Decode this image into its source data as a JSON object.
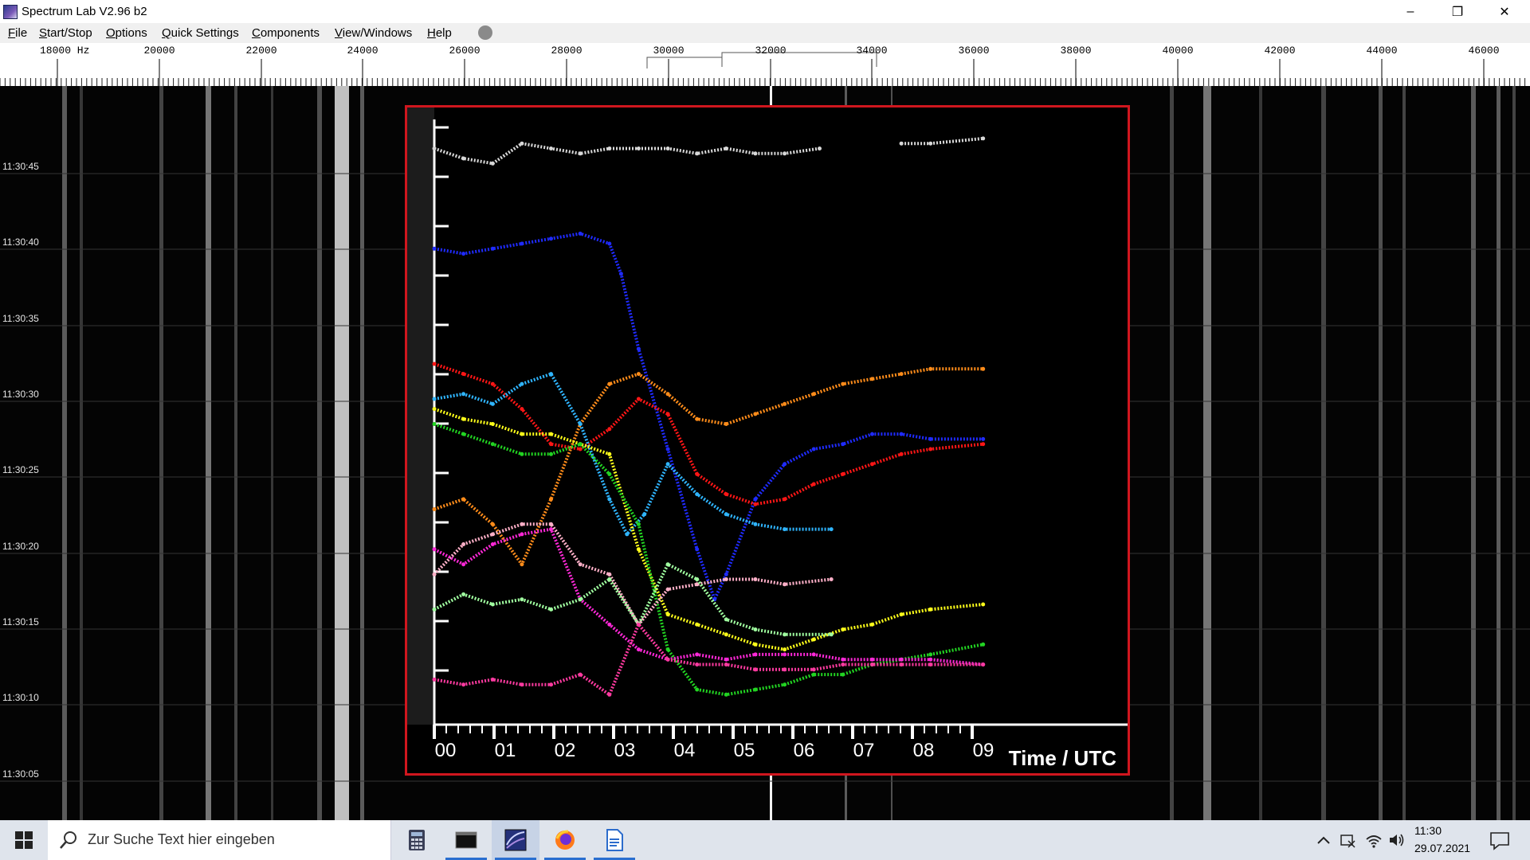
{
  "window": {
    "title": "Spectrum Lab V2.96 b2",
    "minimize_glyph": "–",
    "restore_glyph": "❐",
    "close_glyph": "✕"
  },
  "menu": {
    "items": [
      {
        "label": "File",
        "ul": "F",
        "rest": "ile"
      },
      {
        "label": "Start/Stop",
        "ul": "S",
        "rest": "tart/Stop"
      },
      {
        "label": "Options",
        "ul": "O",
        "rest": "ptions"
      },
      {
        "label": "Quick Settings",
        "ul": "Q",
        "rest": "uick Settings"
      },
      {
        "label": "Components",
        "ul": "C",
        "rest": "omponents"
      },
      {
        "label": "View/Windows",
        "ul": "V",
        "rest": "iew/Windows"
      },
      {
        "label": "Help",
        "ul": "H",
        "rest": "elp"
      }
    ]
  },
  "frequency_scale": {
    "unit": "Hz",
    "labels": [
      "18000 Hz",
      "20000",
      "22000",
      "24000",
      "26000",
      "28000",
      "30000",
      "32000",
      "34000",
      "36000",
      "38000",
      "40000",
      "42000",
      "44000",
      "46000"
    ]
  },
  "waterfall": {
    "time_labels": [
      "11:30:45",
      "11:30:40",
      "11:30:35",
      "11:30:30",
      "11:30:25",
      "11:30:20",
      "11:30:15",
      "11:30:10",
      "11:30:05"
    ]
  },
  "inset_plot": {
    "border_color": "#d0161e",
    "xlabel": "Time / UTC",
    "x_ticks": [
      "00",
      "01",
      "02",
      "03",
      "04",
      "05",
      "06",
      "07",
      "08",
      "09"
    ],
    "chart_data": {
      "type": "scatter",
      "xlabel": "Time / UTC",
      "x_range": [
        0,
        9.5
      ],
      "y_range": [
        0,
        12
      ],
      "series": [
        {
          "color": "#d8d8d8",
          "x": [
            0,
            0.5,
            1,
            1.5,
            2,
            2.5,
            3,
            3.5,
            4,
            4.5,
            5,
            5.5,
            6,
            6.6,
            7.0,
            7.5,
            8,
            8.5,
            9.4
          ],
          "y": [
            11.5,
            11.3,
            11.2,
            11.6,
            11.5,
            11.4,
            11.5,
            11.5,
            11.5,
            11.4,
            11.5,
            11.4,
            11.4,
            11.5,
            null,
            null,
            11.6,
            11.6,
            11.7
          ]
        },
        {
          "color": "#1f2bff",
          "x": [
            0,
            0.5,
            1,
            1.5,
            2,
            2.5,
            3,
            3.2,
            3.5,
            4,
            4.5,
            4.8,
            5,
            5.5,
            6,
            6.5,
            7,
            7.5,
            8,
            8.5,
            9.4
          ],
          "y": [
            9.5,
            9.4,
            9.5,
            9.6,
            9.7,
            9.8,
            9.6,
            9.0,
            7.5,
            5.5,
            3.5,
            2.5,
            3.0,
            4.5,
            5.2,
            5.5,
            5.6,
            5.8,
            5.8,
            5.7,
            5.7
          ]
        },
        {
          "color": "#ff1616",
          "x": [
            0,
            0.5,
            1,
            1.5,
            2,
            2.5,
            3,
            3.5,
            4,
            4.5,
            5,
            5.5,
            6,
            6.5,
            7,
            7.5,
            8,
            8.5,
            9.4
          ],
          "y": [
            7.2,
            7.0,
            6.8,
            6.3,
            5.6,
            5.5,
            5.9,
            6.5,
            6.2,
            5.0,
            4.6,
            4.4,
            4.5,
            4.8,
            5.0,
            5.2,
            5.4,
            5.5,
            5.6
          ]
        },
        {
          "color": "#ff8c1a",
          "x": [
            0,
            0.5,
            1,
            1.5,
            2,
            2.5,
            3,
            3.5,
            4,
            4.5,
            5,
            5.5,
            6,
            6.5,
            7,
            7.5,
            8,
            8.5,
            9.4
          ],
          "y": [
            4.3,
            4.5,
            4.0,
            3.2,
            4.5,
            6.0,
            6.8,
            7.0,
            6.6,
            6.1,
            6.0,
            6.2,
            6.4,
            6.6,
            6.8,
            6.9,
            7.0,
            7.1,
            7.1
          ]
        },
        {
          "color": "#2fb5ff",
          "x": [
            0,
            0.5,
            1,
            1.5,
            2,
            2.5,
            3,
            3.3,
            3.6,
            4,
            4.5,
            5,
            5.5,
            6,
            6.8
          ],
          "y": [
            6.5,
            6.6,
            6.4,
            6.8,
            7.0,
            6.0,
            4.5,
            3.8,
            4.2,
            5.2,
            4.6,
            4.2,
            4.0,
            3.9,
            3.9
          ]
        },
        {
          "color": "#ffff1a",
          "x": [
            0,
            0.5,
            1,
            1.5,
            2,
            2.5,
            3,
            3.5,
            4,
            4.5,
            5,
            5.5,
            6,
            6.5,
            7,
            7.5,
            8,
            8.5,
            9.4
          ],
          "y": [
            6.3,
            6.1,
            6.0,
            5.8,
            5.8,
            5.6,
            5.4,
            3.5,
            2.2,
            2.0,
            1.8,
            1.6,
            1.5,
            1.7,
            1.9,
            2.0,
            2.2,
            2.3,
            2.4
          ]
        },
        {
          "color": "#22d422",
          "x": [
            0,
            0.5,
            1,
            1.5,
            2,
            2.5,
            3,
            3.5,
            4,
            4.5,
            5,
            5.5,
            6,
            6.5,
            7,
            7.5,
            8,
            8.5,
            9.4
          ],
          "y": [
            6.0,
            5.8,
            5.6,
            5.4,
            5.4,
            5.6,
            5.0,
            4.0,
            1.5,
            0.7,
            0.6,
            0.7,
            0.8,
            1.0,
            1.0,
            1.2,
            1.3,
            1.4,
            1.6
          ]
        },
        {
          "color": "#ffb0c8",
          "x": [
            0,
            0.5,
            1,
            1.5,
            2,
            2.5,
            3,
            3.5,
            4,
            4.5,
            5,
            5.5,
            6,
            6.8
          ],
          "y": [
            3.0,
            3.6,
            3.8,
            4.0,
            4.0,
            3.2,
            3.0,
            2.0,
            2.7,
            2.8,
            2.9,
            2.9,
            2.8,
            2.9
          ]
        },
        {
          "color": "#ff28d8",
          "x": [
            0,
            0.5,
            1,
            1.5,
            2,
            2.5,
            3,
            3.5,
            4,
            4.5,
            5,
            5.5,
            6,
            6.5,
            7,
            7.5,
            8,
            8.5,
            9.4
          ],
          "y": [
            3.5,
            3.2,
            3.6,
            3.8,
            3.9,
            2.5,
            2.0,
            1.5,
            1.3,
            1.4,
            1.3,
            1.4,
            1.4,
            1.4,
            1.3,
            1.3,
            1.3,
            1.3,
            1.2
          ]
        },
        {
          "color": "#a0ffa0",
          "x": [
            0,
            0.5,
            1,
            1.5,
            2,
            2.5,
            3,
            3.5,
            4,
            4.5,
            5,
            5.5,
            6,
            6.8
          ],
          "y": [
            2.3,
            2.6,
            2.4,
            2.5,
            2.3,
            2.5,
            2.9,
            2.0,
            3.2,
            2.9,
            2.1,
            1.9,
            1.8,
            1.8
          ]
        },
        {
          "color": "#ff3aa0",
          "x": [
            0,
            0.5,
            1,
            1.5,
            2,
            2.5,
            3,
            3.5,
            4,
            4.5,
            5,
            5.5,
            6,
            6.5,
            7,
            7.5,
            8,
            8.5,
            9.4
          ],
          "y": [
            0.9,
            0.8,
            0.9,
            0.8,
            0.8,
            1.0,
            0.6,
            2.0,
            1.3,
            1.2,
            1.2,
            1.1,
            1.1,
            1.1,
            1.2,
            1.2,
            1.2,
            1.2,
            1.2
          ]
        }
      ]
    }
  },
  "taskbar": {
    "search_placeholder": "Zur Suche Text hier eingeben",
    "time": "11:30",
    "date": "29.07.2021"
  }
}
